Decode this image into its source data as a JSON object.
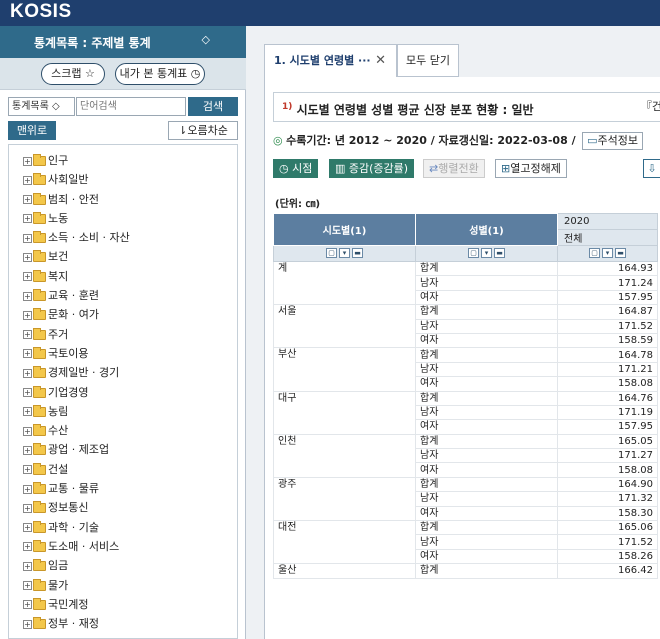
{
  "header": {
    "logo": "KOSIS"
  },
  "sidebar": {
    "title": "통계목록 : 주제별 통계",
    "title_arrow": "◇",
    "scrap_label": "스크랩 ☆",
    "my_tables_label": "내가 본 통계표 ◷",
    "search_select": "통계목록 ◇",
    "search_placeholder": "단어검색",
    "search_button": "검색",
    "top_button": "맨위로",
    "sort_button": "⇂오름차순",
    "tree": [
      "인구",
      "사회일반",
      "범죄 · 안전",
      "노동",
      "소득 · 소비 · 자산",
      "보건",
      "복지",
      "교육 · 훈련",
      "문화 · 여가",
      "주거",
      "국토이용",
      "경제일반 · 경기",
      "기업경영",
      "농림",
      "수산",
      "광업 · 제조업",
      "건설",
      "교통 · 물류",
      "정보통신",
      "과학 · 기술",
      "도소매 · 서비스",
      "임금",
      "물가",
      "국민계정",
      "정부 · 재정"
    ]
  },
  "tabs": {
    "active": "1. 시도별 연령별 ···",
    "close_all": "모두 닫기",
    "close_icon": "✕"
  },
  "table_view": {
    "title_sup": "1)",
    "title": "시도별 연령별 성별 평균 신장 분포 현황 : 일반",
    "title_more": "『건",
    "period_dot": "◎",
    "period_text": "수록기간: 년 2012 ~ 2020 / 자료갱신일: 2022-03-08 /",
    "note_button": "주석정보",
    "btn_time": "◷ 시점",
    "btn_change": "▥ 증감(증감률)",
    "btn_pivot": "행렬전환",
    "btn_fix": "열고정해제",
    "unit": "(단위: ㎝)",
    "col_region": "시도별(1)",
    "col_gender": "성별(1)",
    "col_year": "2020",
    "col_total": "전체",
    "ctrl": [
      "▢",
      "▾",
      "▬"
    ],
    "rows": [
      {
        "region": "계",
        "items": [
          [
            "합계",
            "164.93"
          ],
          [
            "남자",
            "171.24"
          ],
          [
            "여자",
            "157.95"
          ]
        ]
      },
      {
        "region": "서울",
        "items": [
          [
            "합계",
            "164.87"
          ],
          [
            "남자",
            "171.52"
          ],
          [
            "여자",
            "158.59"
          ]
        ]
      },
      {
        "region": "부산",
        "items": [
          [
            "합계",
            "164.78"
          ],
          [
            "남자",
            "171.21"
          ],
          [
            "여자",
            "158.08"
          ]
        ]
      },
      {
        "region": "대구",
        "items": [
          [
            "합계",
            "164.76"
          ],
          [
            "남자",
            "171.19"
          ],
          [
            "여자",
            "157.95"
          ]
        ]
      },
      {
        "region": "인천",
        "items": [
          [
            "합계",
            "165.05"
          ],
          [
            "남자",
            "171.27"
          ],
          [
            "여자",
            "158.08"
          ]
        ]
      },
      {
        "region": "광주",
        "items": [
          [
            "합계",
            "164.90"
          ],
          [
            "남자",
            "171.32"
          ],
          [
            "여자",
            "158.30"
          ]
        ]
      },
      {
        "region": "대전",
        "items": [
          [
            "합계",
            "165.06"
          ],
          [
            "남자",
            "171.52"
          ],
          [
            "여자",
            "158.26"
          ]
        ]
      },
      {
        "region": "울산",
        "items": [
          [
            "합계",
            "166.42"
          ]
        ]
      }
    ]
  }
}
